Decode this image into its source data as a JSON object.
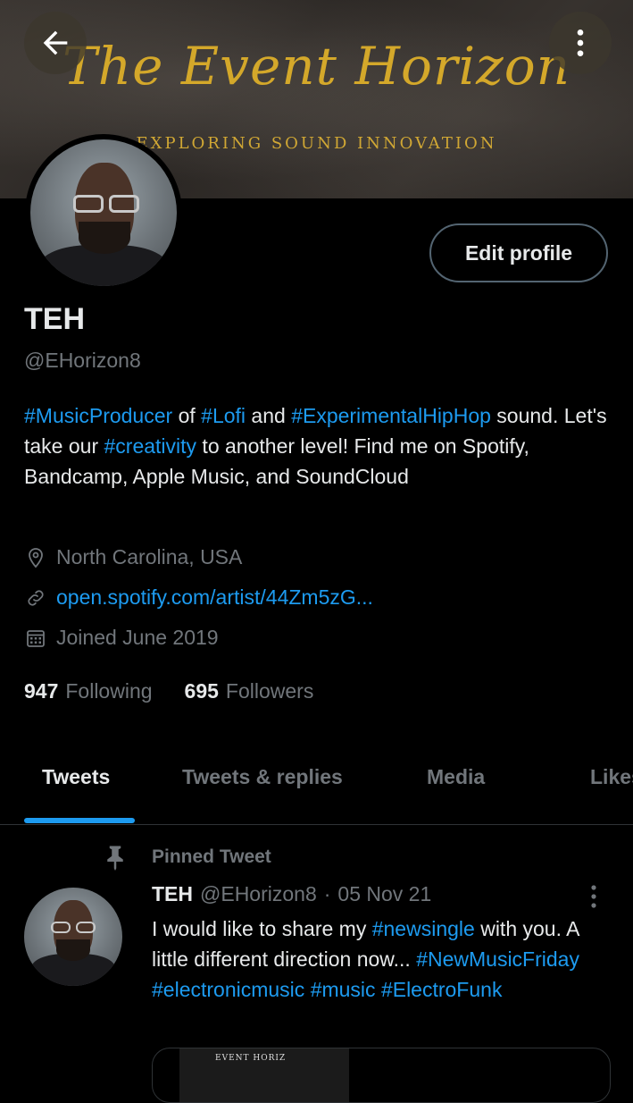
{
  "banner": {
    "title": "The Event Horizon",
    "subtitle": "EXPLORING SOUND INNOVATION",
    "brand_color": "#d4a82a"
  },
  "icons": {
    "back": "arrow-left-icon",
    "more": "more-vertical-icon",
    "location": "location-pin-icon",
    "link": "link-icon",
    "calendar": "calendar-icon",
    "pin": "pin-icon"
  },
  "profile": {
    "edit_label": "Edit profile",
    "name": "TEH",
    "handle": "@EHorizon8",
    "bio": {
      "t1": "#MusicProducer",
      "s1": " of ",
      "t2": "#Lofi",
      "s2": " and ",
      "t3": "#ExperimentalHipHop",
      "s3": " sound. Let's take our ",
      "t4": "#creativity",
      "s4": " to another level! Find me on Spotify, Bandcamp, Apple Music, and SoundCloud"
    },
    "location": "North Carolina, USA",
    "website": "open.spotify.com/artist/44Zm5zG...",
    "joined": "Joined June 2019",
    "following_count": "947",
    "following_label": "Following",
    "followers_count": "695",
    "followers_label": "Followers"
  },
  "tabs": [
    {
      "label": "Tweets",
      "active": true
    },
    {
      "label": "Tweets & replies",
      "active": false
    },
    {
      "label": "Media",
      "active": false
    },
    {
      "label": "Likes",
      "active": false
    }
  ],
  "pinned_tweet": {
    "pinned_label": "Pinned Tweet",
    "author_name": "TEH",
    "author_handle": "@EHorizon8",
    "separator": "·",
    "date": "05 Nov 21",
    "text": {
      "s1": "I would like to share my ",
      "t1": "#newsingle",
      "s2": " with you. A little different direction now... ",
      "t2": "#NewMusicFriday",
      "s3": " ",
      "t3": "#electronicmusic",
      "s4": " ",
      "t4": "#music",
      "s5": " ",
      "t5": "#ElectroFunk"
    },
    "media_text": "EVENT HORIZ"
  },
  "colors": {
    "accent": "#1d9bf0",
    "text": "#e7e9ea",
    "muted": "#71767b",
    "border": "#2f3336",
    "background": "#000000"
  }
}
